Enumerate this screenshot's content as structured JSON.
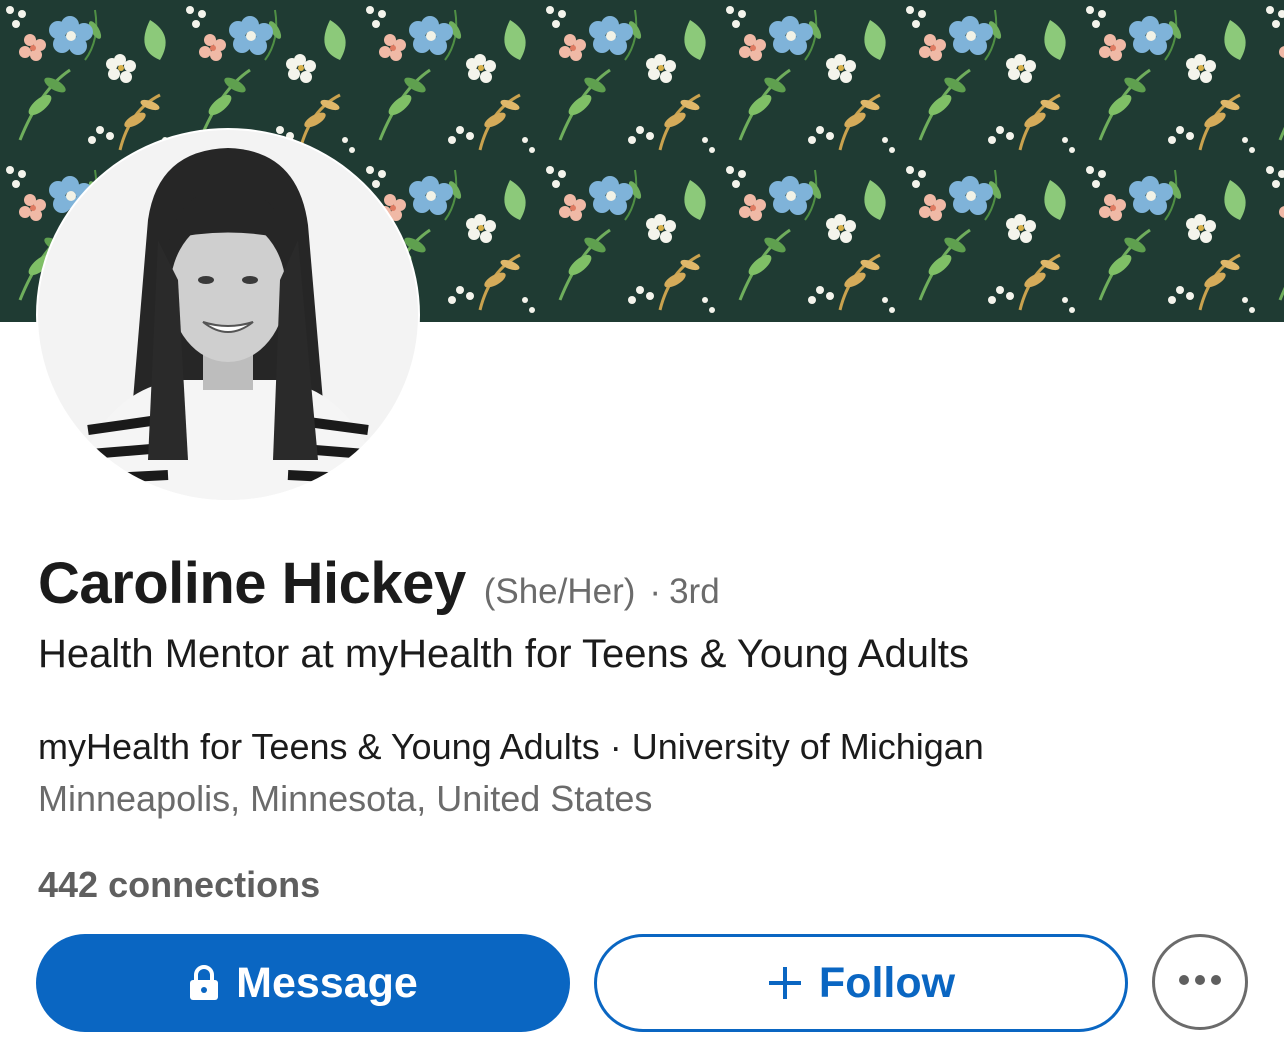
{
  "profile": {
    "name": "Caroline Hickey",
    "pronouns": "(She/Her)",
    "degree_separator": "·",
    "degree": "3rd",
    "headline": "Health Mentor at myHealth for Teens & Young Adults",
    "workplace": "myHealth for Teens & Young Adults · University of Michigan",
    "location": "Minneapolis, Minnesota, United States",
    "connections": "442 connections"
  },
  "actions": {
    "message_label": "Message",
    "message_icon": "lock-icon",
    "follow_label": "Follow",
    "follow_icon": "plus-icon",
    "more_icon": "more-horizontal-icon"
  },
  "colors": {
    "accent": "#0a66c2",
    "banner_bg": "#1f3b33",
    "text_primary": "#1b1b1b",
    "text_secondary": "#6b6b6b"
  }
}
